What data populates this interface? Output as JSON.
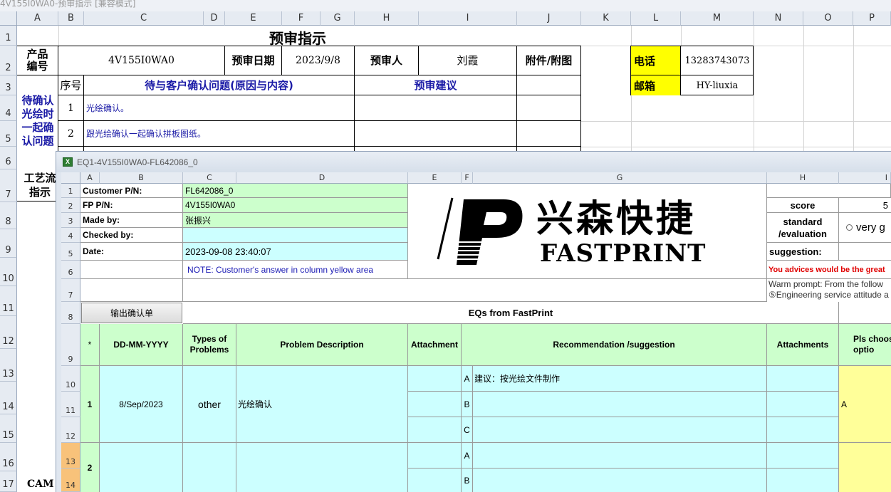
{
  "window_title": "4V155I0WA0-预审指示  [兼容模式]",
  "outer": {
    "col_headers": [
      "A",
      "B",
      "C",
      "D",
      "E",
      "F",
      "G",
      "H",
      "I",
      "J",
      "K",
      "L",
      "M",
      "N",
      "O",
      "P"
    ],
    "row_headers": [
      "1",
      "2",
      "3",
      "4",
      "5",
      "6",
      "7",
      "8",
      "9",
      "10",
      "11",
      "12",
      "13",
      "14",
      "15",
      "16",
      "17"
    ],
    "title": "预审指示",
    "product_label": "产品\n编号",
    "product_value": "4V155I0WA0",
    "review_date_label": "预审日期",
    "review_date_value": "2023/9/8",
    "reviewer_label": "预审人",
    "reviewer_value": "刘霞",
    "attach_label": "附件/附图",
    "phone_label": "电话",
    "phone_value": "13283743073",
    "email_label": "邮箱",
    "email_value": "HY-liuxia",
    "seq_label": "序号",
    "issue_header": "待与客户确认问题(原因与内容)",
    "suggest_header": "预审建议",
    "side_label": "待确认\n光绘时\n一起确\n认问题",
    "rows": [
      {
        "no": "1",
        "text": "光绘确认。"
      },
      {
        "no": "2",
        "text": "跟光绘确认一起确认拼板图纸。"
      }
    ],
    "process_label": "工艺流\n指示",
    "cam_label": "CAM"
  },
  "inner": {
    "title": "EQ1-4V155I0WA0-FL642086_0",
    "col_headers": [
      "A",
      "B",
      "C",
      "D",
      "E",
      "F",
      "G",
      "H",
      "I"
    ],
    "row_headers": [
      "1",
      "2",
      "3",
      "4",
      "5",
      "6",
      "7",
      "8",
      "9",
      "10",
      "11",
      "12",
      "13",
      "14"
    ],
    "customer_pn_label": "Customer P/N:",
    "customer_pn_value": "FL642086_0",
    "fp_pn_label": "FP P/N:",
    "fp_pn_value": "4V155I0WA0",
    "made_by_label": "Made by:",
    "made_by_value": "张振兴",
    "checked_by_label": "Checked by:",
    "date_label": "Date:",
    "date_value": "2023-09-08 23:40:07",
    "note": "NOTE: Customer's  answer in column yellow area",
    "logo_cn": "兴森快捷",
    "logo_en": "FASTPRINT",
    "score_label": "score",
    "score_value": "5",
    "standard_label": "standard\n/evaluation",
    "standard_option": "very g",
    "suggestion_label": "suggestion:",
    "advice_red": "You advices would be the great",
    "warm_prompt": "Warm prompt:  From the follow",
    "service_line": "⑤Engineering service attitude a",
    "output_button": "输出确认单",
    "eq_header": "EQs from FastPrint",
    "table_headers": {
      "star": "*",
      "date": "DD-MM-YYYY",
      "types": "Types of\nProblems",
      "problem": "Problem Description",
      "attachment": "Attachment",
      "recommendation": "Recommendation /suggestion",
      "attachments": "Attachments",
      "pls_choose": "Pls choos\noptio"
    },
    "eqs": [
      {
        "no": "1",
        "date": "8/Sep/2023",
        "type": "other",
        "problem": "光绘确认",
        "options": [
          {
            "letter": "A",
            "text": "建议：按光绘文件制作"
          },
          {
            "letter": "B",
            "text": ""
          },
          {
            "letter": "C",
            "text": ""
          }
        ],
        "choice": "A"
      },
      {
        "no": "2",
        "date": "",
        "type": "",
        "problem": "",
        "options": [
          {
            "letter": "A",
            "text": ""
          },
          {
            "letter": "B",
            "text": ""
          }
        ],
        "choice": ""
      }
    ]
  }
}
